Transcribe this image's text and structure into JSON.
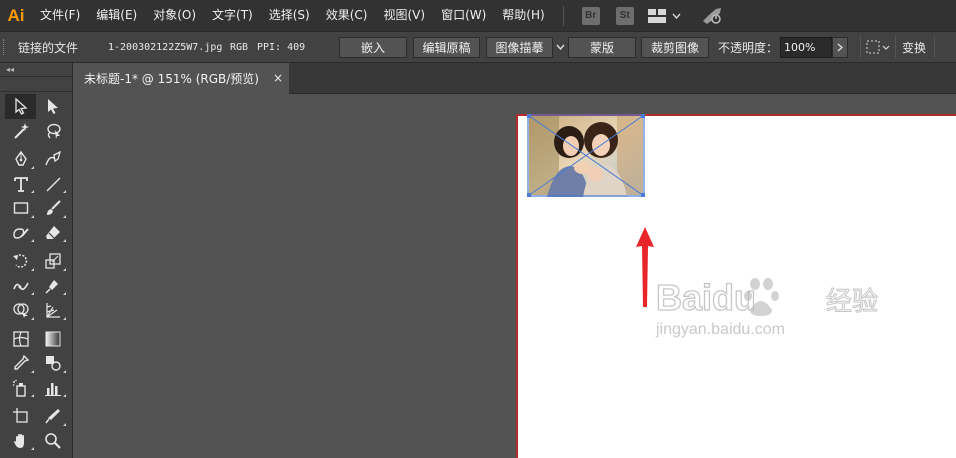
{
  "app": {
    "logo": "Ai",
    "brand_color": "#ff9a00"
  },
  "menu": {
    "items": [
      "文件(F)",
      "编辑(E)",
      "对象(O)",
      "文字(T)",
      "选择(S)",
      "效果(C)",
      "视图(V)",
      "窗口(W)",
      "帮助(H)"
    ],
    "badges": [
      "Br",
      "St"
    ],
    "icons": [
      "workspace-layout-icon",
      "chevron-down-icon",
      "gpu-rocket-icon"
    ]
  },
  "control_bar": {
    "linked_file_label": "链接的文件",
    "file_name": "1-200302122Z5W7.jpg",
    "color_mode": "RGB",
    "ppi": "PPI: 409",
    "buttons": {
      "embed": "嵌入",
      "edit_original": "编辑原稿",
      "image_trace": "图像描摹",
      "mask": "蒙版",
      "crop_image": "裁剪图像"
    },
    "opacity_label": "不透明度：",
    "opacity_value": "100%",
    "transform_label": "变换"
  },
  "document": {
    "tab_title": "未标题-1* @ 151% (RGB/预览)",
    "close_symbol": "×",
    "artboard_border_color": "#b22a2a"
  },
  "tools": [
    "selection-tool-icon",
    "direct-selection-tool-icon",
    "magic-wand-tool-icon",
    "lasso-tool-icon",
    "pen-tool-icon",
    "curvature-tool-icon",
    "type-tool-icon",
    "line-segment-tool-icon",
    "rectangle-tool-icon",
    "paintbrush-tool-icon",
    "shaper-tool-icon",
    "eraser-tool-icon",
    "rotate-tool-icon",
    "scale-tool-icon",
    "width-tool-icon",
    "puppet-warp-tool-icon",
    "shape-builder-tool-icon",
    "perspective-grid-tool-icon",
    "mesh-tool-icon",
    "gradient-tool-icon",
    "eyedropper-tool-icon",
    "blend-tool-icon",
    "symbol-sprayer-tool-icon",
    "column-graph-tool-icon",
    "artboard-tool-icon",
    "slice-tool-icon",
    "hand-tool-icon",
    "zoom-tool-icon"
  ],
  "watermark": {
    "brand": "Baidu",
    "suffix": "经验",
    "url": "jingyan.baidu.com"
  },
  "annotation": {
    "arrow_color": "#e8262a"
  }
}
